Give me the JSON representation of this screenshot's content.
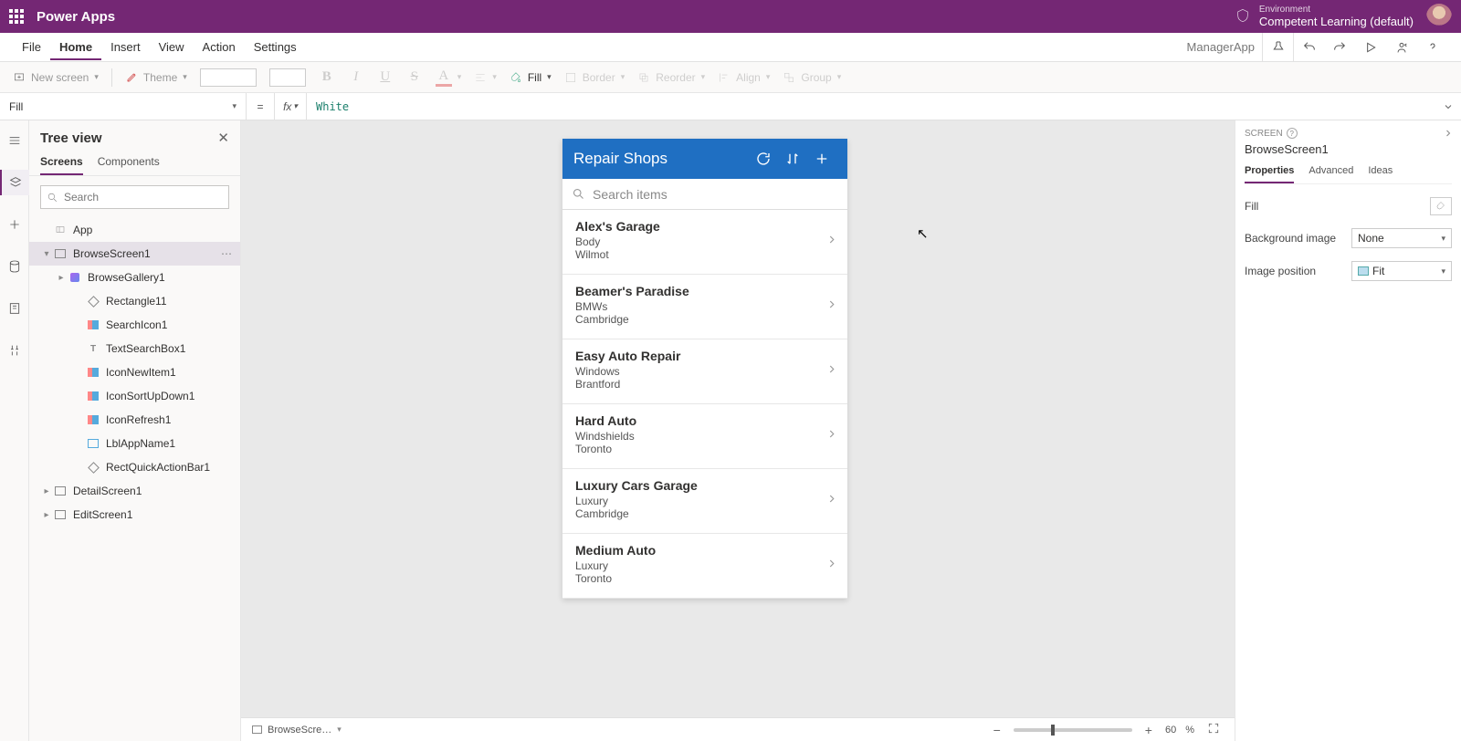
{
  "titlebar": {
    "app_name": "Power Apps",
    "env_label": "Environment",
    "env_value": "Competent Learning (default)"
  },
  "menu": {
    "file": "File",
    "home": "Home",
    "insert": "Insert",
    "view": "View",
    "action": "Action",
    "settings": "Settings",
    "right_name": "ManagerApp"
  },
  "ribbon": {
    "new_screen": "New screen",
    "theme": "Theme",
    "fill": "Fill",
    "border": "Border",
    "reorder": "Reorder",
    "align": "Align",
    "group": "Group"
  },
  "formula": {
    "property": "Fill",
    "eq": "=",
    "fx": "fx",
    "value": "White"
  },
  "tree": {
    "title": "Tree view",
    "tab_screens": "Screens",
    "tab_components": "Components",
    "search_placeholder": "Search",
    "nodes": {
      "app": "App",
      "browse": "BrowseScreen1",
      "gallery": "BrowseGallery1",
      "rect11": "Rectangle11",
      "searchicon": "SearchIcon1",
      "textsearch": "TextSearchBox1",
      "iconnew": "IconNewItem1",
      "iconsort": "IconSortUpDown1",
      "iconrefresh": "IconRefresh1",
      "lblapp": "LblAppName1",
      "rectquick": "RectQuickActionBar1",
      "detail": "DetailScreen1",
      "edit": "EditScreen1"
    }
  },
  "phone": {
    "title": "Repair Shops",
    "search_placeholder": "Search items",
    "rows": [
      {
        "t1": "Alex's Garage",
        "t2": "Body",
        "t3": "Wilmot"
      },
      {
        "t1": "Beamer's Paradise",
        "t2": "BMWs",
        "t3": "Cambridge"
      },
      {
        "t1": "Easy Auto Repair",
        "t2": "Windows",
        "t3": "Brantford"
      },
      {
        "t1": "Hard Auto",
        "t2": "Windshields",
        "t3": "Toronto"
      },
      {
        "t1": "Luxury Cars Garage",
        "t2": "Luxury",
        "t3": "Cambridge"
      },
      {
        "t1": "Medium Auto",
        "t2": "Luxury",
        "t3": "Toronto"
      }
    ]
  },
  "props": {
    "type_label": "SCREEN",
    "name": "BrowseScreen1",
    "tab_properties": "Properties",
    "tab_advanced": "Advanced",
    "tab_ideas": "Ideas",
    "fill_label": "Fill",
    "bgimg_label": "Background image",
    "bgimg_value": "None",
    "imgpos_label": "Image position",
    "imgpos_value": "Fit"
  },
  "status": {
    "breadcrumb": "BrowseScre…",
    "zoom": "60",
    "zoom_unit": "%"
  }
}
